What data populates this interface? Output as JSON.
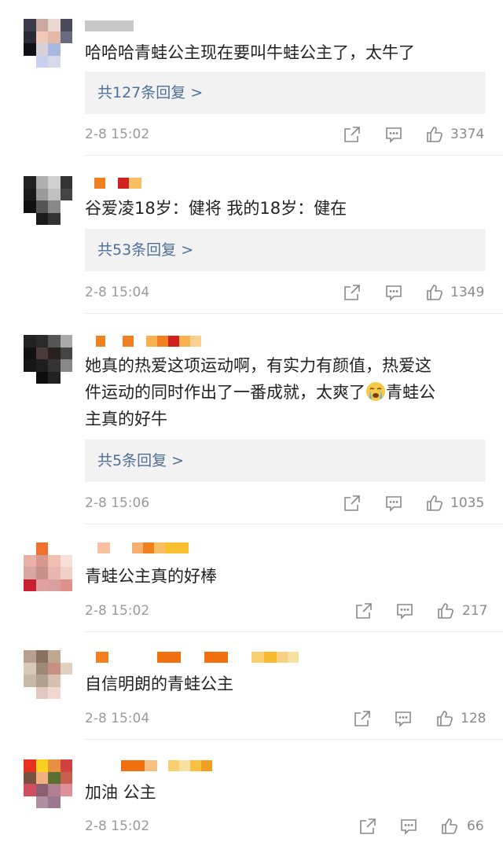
{
  "colors": {
    "link": "#4e6f98",
    "meta": "#9a9a9a",
    "reply_bg": "#f2f2f2"
  },
  "comments": [
    {
      "text": "哈哈哈青蛙公主现在要叫牛蛙公主了，太牛了",
      "replies": "共127条回复 >",
      "time": "2-8 15:02",
      "likes": "3374"
    },
    {
      "text": "谷爱凌18岁：健将 我的18岁：健在",
      "replies": "共53条回复 >",
      "time": "2-8 15:04",
      "likes": "1349"
    },
    {
      "text_line1": "她真的热爱这项运动啊，有实力有颜值，热爱这",
      "text_line2a": "件运动的同时作出了一番成就，太爽了",
      "emoji": "crying-face-emoji",
      "text_line2b": "青蛙公",
      "text_line3": "主真的好牛",
      "replies": "共5条回复 >",
      "time": "2-8 15:06",
      "likes": "1035"
    },
    {
      "text": "青蛙公主真的好棒",
      "time": "2-8 15:02",
      "likes": "217"
    },
    {
      "text": "自信明朗的青蛙公主",
      "time": "2-8 15:04",
      "likes": "128"
    },
    {
      "text": "加油 公主",
      "time": "2-8 15:02",
      "likes": "66"
    }
  ]
}
